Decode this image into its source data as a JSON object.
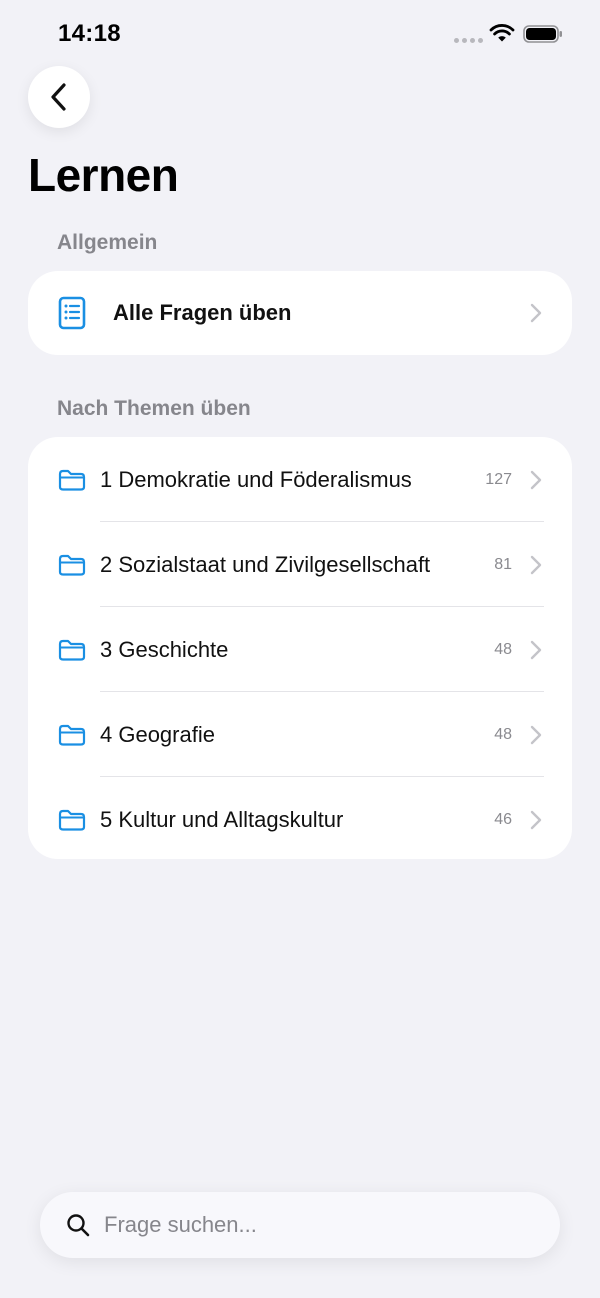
{
  "status_bar": {
    "time": "14:18"
  },
  "nav": {
    "back_icon": "chevron-left-icon"
  },
  "page": {
    "title": "Lernen"
  },
  "sections": {
    "general": {
      "header": "Allgemein",
      "item": {
        "label": "Alle Fragen üben",
        "icon": "list-document-icon"
      }
    },
    "topics": {
      "header": "Nach Themen üben",
      "items": [
        {
          "label": "1 Demokratie und Föderalismus",
          "count": "127",
          "icon": "folder-icon"
        },
        {
          "label": "2 Sozialstaat und Zivilgesellschaft",
          "count": "81",
          "icon": "folder-icon"
        },
        {
          "label": "3 Geschichte",
          "count": "48",
          "icon": "folder-icon"
        },
        {
          "label": "4 Geografie",
          "count": "48",
          "icon": "folder-icon"
        },
        {
          "label": "5 Kultur und Alltagskultur",
          "count": "46",
          "icon": "folder-icon"
        }
      ]
    }
  },
  "search": {
    "placeholder": "Frage suchen...",
    "value": "",
    "icon": "search-icon"
  },
  "colors": {
    "accent": "#1a8fe3",
    "background": "#f2f2f7",
    "secondary_text": "#86868c"
  }
}
